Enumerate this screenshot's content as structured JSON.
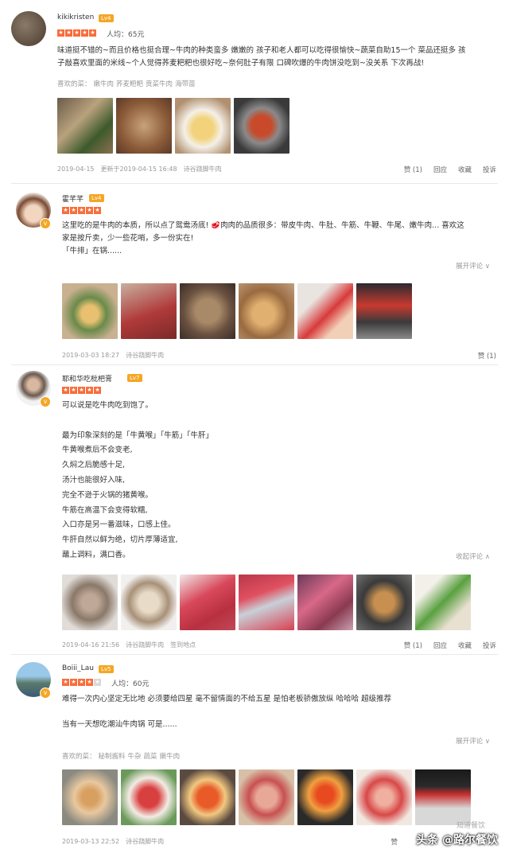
{
  "reviews": [
    {
      "username": "kikikristen",
      "level": "Lv4",
      "rating": 5,
      "avg_price": "人均：65元",
      "text": [
        "味道挺不错的~而且价格也挺合理~牛肉的种类蛮多 嫩嫩的 孩子和老人都可以吃得很愉快~蔬菜自助15一个 菜品还挺多 孩",
        "子敲喜欢里面的米线~个人觉得荞麦粑粑也很好吃~奈何肚子有限 口碑吹爆的牛肉饼没吃到~没关系 下次再战!"
      ],
      "liked_label": "喜欢的菜：",
      "liked": [
        "嫩牛肉",
        "荞麦粑粑",
        "贡菜牛肉",
        "海带苗"
      ],
      "meta": [
        "2019-04-15",
        "更新于2019-04-15 16:48",
        "诗谷跷脚牛肉"
      ],
      "actions": [
        "赞 (1)",
        "回应",
        "收藏",
        "投诉"
      ]
    },
    {
      "username": "霍芊芊",
      "level": "Lv4",
      "rating": 5,
      "text": [
        "这里吃的是牛肉的本质，所以点了鸳鸯汤底! 🥩肉肉的品质很多：带皮牛肉、牛肚、牛筋、牛鞭、牛尾、嫩牛肉... 喜欢这",
        "家是按斤卖，少一些花哨，多一份实在!",
        "「牛排」在锅......"
      ],
      "toggle": "展开评论 ∨",
      "meta": [
        "2019-03-03 18:27",
        "诗谷跷脚牛肉"
      ],
      "actions": [
        "赞 (1)"
      ]
    },
    {
      "username": "耶和华吃枇杷膏",
      "level": "Lv7",
      "rating": 5,
      "text": [
        "可以说是吃牛肉吃到饱了。",
        "",
        "最为印象深刻的是「牛黄喉」「牛筋」「牛肝」",
        "牛黄喉煮后不会变老,",
        "久焖之后脆感十足,",
        "汤汁也能很好入味,",
        "完全不逊于火锅的猪黄喉。",
        "牛筋在高温下会变得软糯,",
        "入口亦是另一番滋味，口感上佳。",
        "牛肝自然以鲜为绝，切片厚薄适宜,",
        "蘸上调料，满口香。"
      ],
      "toggle": "收起评论 ∧",
      "meta": [
        "2019-04-16 21:56",
        "诗谷跷脚牛肉",
        "签到地点"
      ],
      "actions": [
        "赞 (1)",
        "回应",
        "收藏",
        "投诉"
      ]
    },
    {
      "username": "Boiii_Lau",
      "level": "Lv5",
      "rating": 4,
      "avg_price": "人均：60元",
      "text": [
        "难得一次内心坚定无比地 必须要给四星 毫不留情面的不给五星 是怕老板骄傲放纵 哈哈哈 超级推荐",
        "",
        "当有一天想吃潮汕牛肉锅 可是......"
      ],
      "toggle": "展开评论 ∨",
      "liked_label": "喜欢的菜：",
      "liked": [
        "秘制酱料",
        "牛杂",
        "蔬菜",
        "嫩牛肉"
      ],
      "meta": [
        "2019-03-13 22:52",
        "诗谷跷脚牛肉"
      ],
      "actions": [
        "赞"
      ]
    }
  ],
  "watermark": "头条 @路尔餐饮",
  "watermark_faint": "知道餐饮"
}
